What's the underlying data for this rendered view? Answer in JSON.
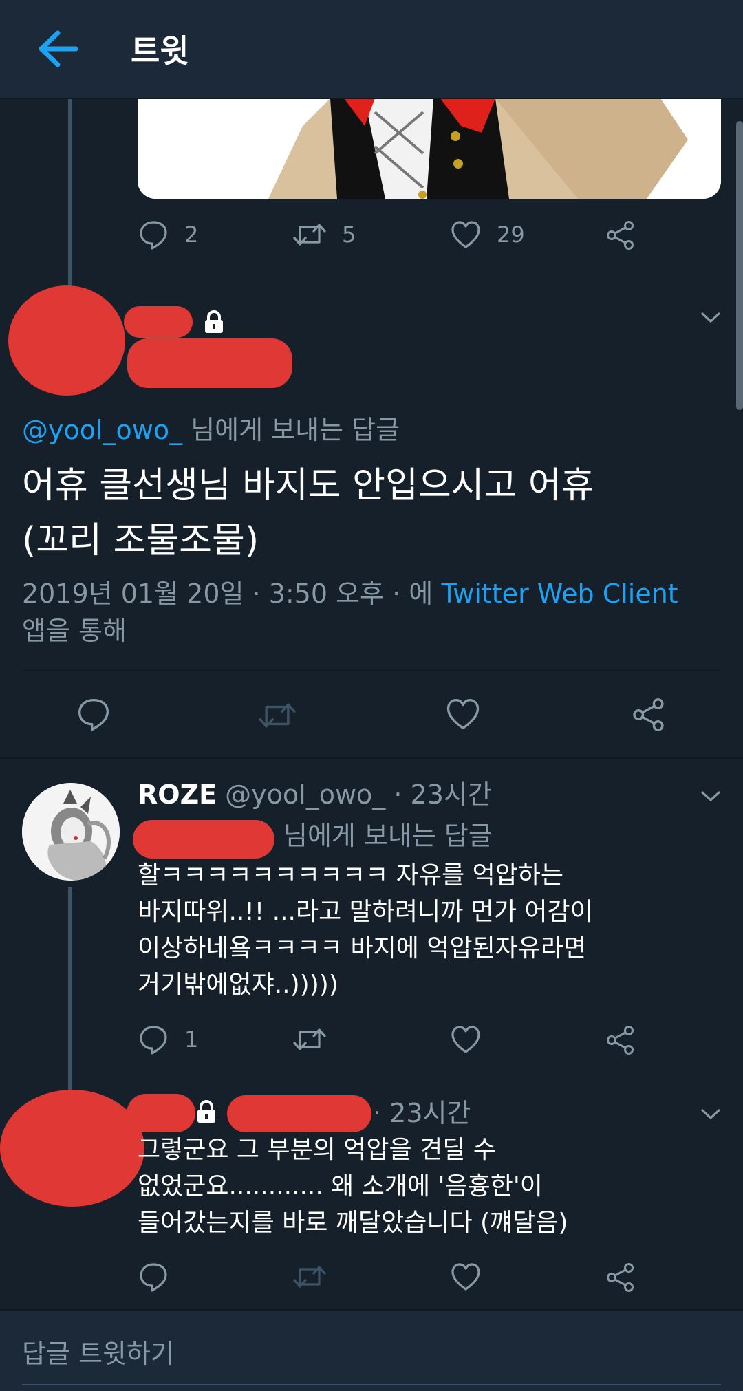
{
  "header": {
    "title": "트윗"
  },
  "prev_tweet": {
    "counts": {
      "replies": "2",
      "retweets": "5",
      "likes": "29"
    }
  },
  "main_tweet": {
    "reply_to_handle": "@yool_owo_",
    "reply_to_suffix": "님에게 보내는 답글",
    "text_line1": "어휴 클선생님 바지도 안입으시고 어휴",
    "text_line2": "(꼬리 조물조물)",
    "meta_prefix": "2019년 01월 20일 · 3:50 오후 · 에",
    "client": "Twitter Web Client",
    "meta_suffix": "앱을 통해"
  },
  "reply1": {
    "name": "ROZE",
    "handle": "@yool_owo_",
    "time": "· 23시간",
    "reply_to_suffix": "님에게 보내는 답글",
    "lines": [
      "할ㅋㅋㅋㅋㅋㅋㅋㅋㅋㅋ 자유를 억압하는",
      "바지따위..!! ...라고 말하려니까 먼가 어감이",
      "이상하네욬ㅋㅋㅋㅋ 바지에 억압된자유라면",
      "거기밖에없쟈..)))))"
    ],
    "counts": {
      "replies": "1"
    }
  },
  "reply2": {
    "time": "· 23시간",
    "lines": [
      "그렇군요 그 부분의 억압을 견딜 수",
      "없었군요............ 왜 소개에 '음흉한'이",
      "들어갔는지를 바로 깨달았습니다 (꺠달음)"
    ]
  },
  "footer": {
    "placeholder": "답글 트윗하기"
  },
  "colors": {
    "background": "#15202b",
    "header": "#1c2938",
    "accent": "#1da1f2",
    "muted": "#8899a6",
    "redaction": "#e03834"
  }
}
